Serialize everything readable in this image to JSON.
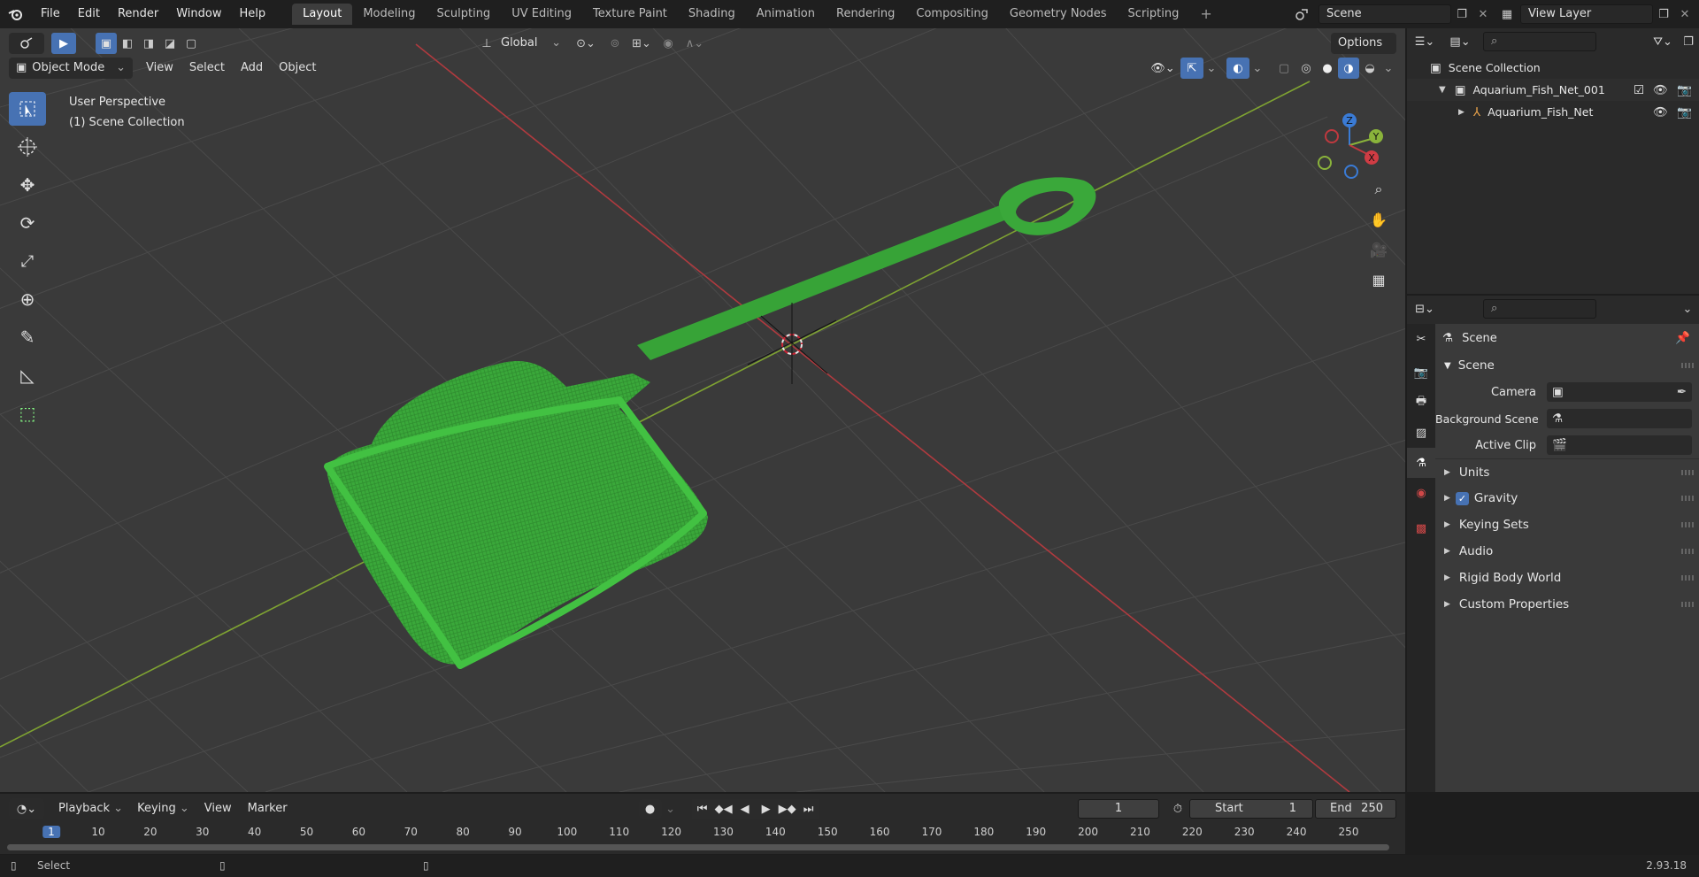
{
  "menus": [
    "File",
    "Edit",
    "Render",
    "Window",
    "Help"
  ],
  "workspaces": [
    "Layout",
    "Modeling",
    "Sculpting",
    "UV Editing",
    "Texture Paint",
    "Shading",
    "Animation",
    "Rendering",
    "Compositing",
    "Geometry Nodes",
    "Scripting"
  ],
  "active_workspace": "Layout",
  "scene_name": "Scene",
  "view_layer": "View Layer",
  "viewport": {
    "orientation": "Global",
    "options_label": "Options",
    "mode": "Object Mode",
    "menu_view": "View",
    "menu_select": "Select",
    "menu_add": "Add",
    "menu_object": "Object",
    "perspective_label": "User Perspective",
    "collection_label": "(1) Scene Collection",
    "gizmo": {
      "x": "X",
      "y": "Y",
      "z": "Z"
    }
  },
  "outliner": {
    "root": "Scene Collection",
    "collection": "Aquarium_Fish_Net_001",
    "object": "Aquarium_Fish_Net"
  },
  "properties": {
    "context": "Scene",
    "panel": "Scene",
    "camera_label": "Camera",
    "background_label": "Background Scene",
    "clip_label": "Active Clip",
    "sections": [
      "Units",
      "Gravity",
      "Keying Sets",
      "Audio",
      "Rigid Body World",
      "Custom Properties"
    ]
  },
  "timeline": {
    "playback": "Playback",
    "keying": "Keying",
    "view": "View",
    "marker": "Marker",
    "current_frame": "1",
    "start_label": "Start",
    "start_value": "1",
    "end_label": "End",
    "end_value": "250",
    "ticks": [
      "1",
      "10",
      "20",
      "30",
      "40",
      "50",
      "60",
      "70",
      "80",
      "90",
      "100",
      "110",
      "120",
      "130",
      "140",
      "150",
      "160",
      "170",
      "180",
      "190",
      "200",
      "210",
      "220",
      "230",
      "240",
      "250"
    ]
  },
  "status": {
    "left": "Select",
    "version": "2.93.18"
  },
  "colors": {
    "accent": "#4772b3",
    "mesh_green": "#3fae3f",
    "x_axis": "#c0393f",
    "y_axis": "#8ab33b"
  }
}
